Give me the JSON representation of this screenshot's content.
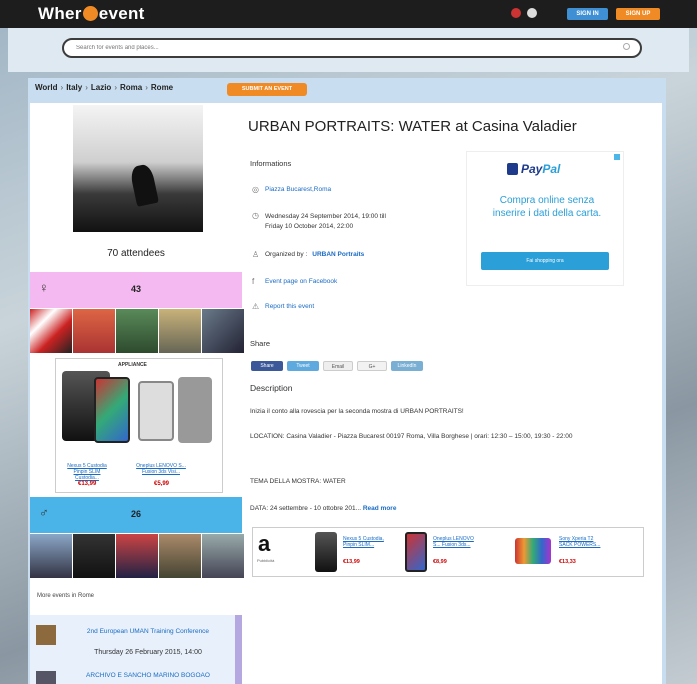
{
  "header": {
    "logo_text_left": "Wher",
    "logo_text_right": "event",
    "signin_label": "SIGN IN",
    "signup_label": "SIGN UP"
  },
  "search": {
    "placeholder": "Search for events and places..."
  },
  "breadcrumb": {
    "items": [
      "World",
      "Italy",
      "Lazio",
      "Roma",
      "Rome"
    ],
    "submit_label": "SUBMIT AN EVENT"
  },
  "left": {
    "attendees": "70 attendees",
    "female_count": "43",
    "male_count": "26",
    "ad_title": "APPLIANCE",
    "ad_products": [
      {
        "name": "Nexus 5 Custodia Pinpin SLIM Custodia...",
        "price": "€13,99"
      },
      {
        "name": "Oneplus LENOVO S... Fusion 3ds Visi...",
        "price": "€5,99"
      }
    ],
    "more_events_label": "More events in Rome",
    "events": [
      {
        "title": "2nd European UMAN Training Conference",
        "date": "Thursday 26 February 2015, 14:00"
      },
      {
        "title": "ARCHIVO E SANCHO MARINO BOGOAO",
        "date": ""
      }
    ]
  },
  "event": {
    "title": "URBAN PORTRAITS: WATER at Casina Valadier",
    "info_heading": "Informations",
    "location": "Piazza Bucarest,Roma",
    "date_line1": "Wednesday 24 September 2014, 19:00 till",
    "date_line2": "Friday 10 October 2014, 22:00",
    "organized_prefix": "Organized by :",
    "organizer": "URBAN Portraits",
    "facebook_link": "Event page on Facebook",
    "report_link": "Report this event",
    "share_heading": "Share",
    "share_buttons": [
      "Share",
      "Tweet",
      "Email",
      "G+",
      "LinkedIn"
    ],
    "desc_heading": "Description",
    "desc_p1": "Inizia il conto alla rovescia per la seconda mostra di URBAN PORTRAITS!",
    "desc_p2": "LOCATION: Casina Valadier - Piazza Bucarest 00197 Roma, Villa Borghese | orari: 12:30 – 15:00, 19:30 - 22:00",
    "desc_p3": "TEMA DELLA MOSTRA: WATER",
    "desc_p4": "DATA: 24 settembre - 10 ottobre 201...",
    "read_more": "Read more"
  },
  "paypal_ad": {
    "logo_pay": "Pay",
    "logo_pal": "Pal",
    "text": "Compra online senza inserire i dati della carta.",
    "button": "Fai shopping ora"
  },
  "bottom_ad": {
    "brand": "a",
    "brand_sub": "Pubblicità",
    "products": [
      {
        "name": "Nexus 5 Custodia, Pinpin SLIM...",
        "price": "€13,99"
      },
      {
        "name": "Oneplus LENOVO S... Fusion 3ds...",
        "price": "€8,99"
      },
      {
        "name": "Sony Xperia T2 SACK POWERS...",
        "price": "€13,33"
      }
    ]
  },
  "colors": {
    "accent_orange": "#f08a24",
    "accent_blue": "#3e8fd4",
    "female_pink": "#f4b9f0",
    "male_blue": "#4ab3e8",
    "link_blue": "#1a6bc4"
  }
}
